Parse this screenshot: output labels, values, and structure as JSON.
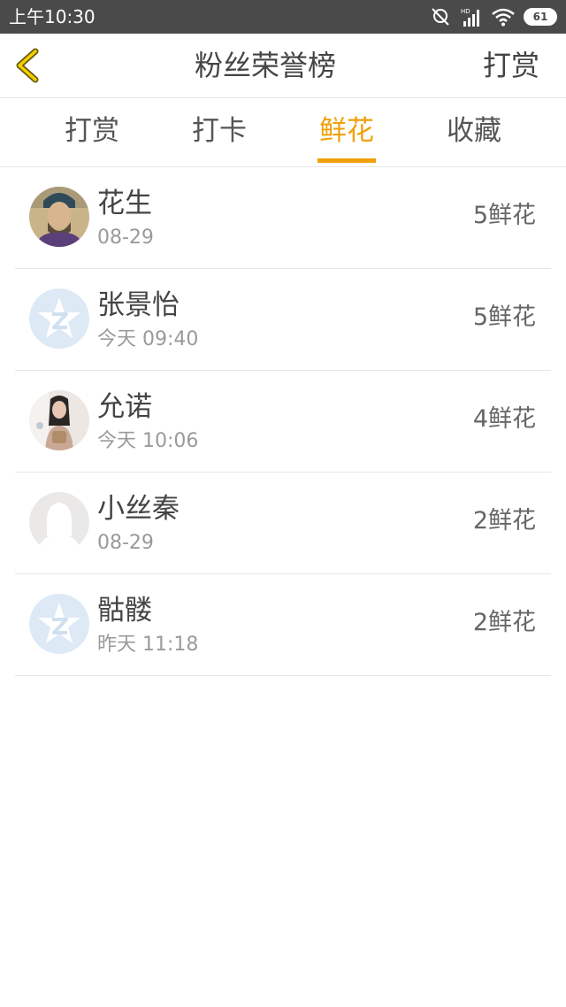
{
  "status_bar": {
    "time": "上午10:30",
    "hd_label": "HD",
    "battery": "61"
  },
  "header": {
    "title": "粉丝荣誉榜",
    "action": "打赏"
  },
  "tabs": [
    {
      "label": "打赏",
      "active": false
    },
    {
      "label": "打卡",
      "active": false
    },
    {
      "label": "鲜花",
      "active": true
    },
    {
      "label": "收藏",
      "active": false
    }
  ],
  "colors": {
    "accent": "#f0a00a",
    "status_bar": "#4a4a4a"
  },
  "list": [
    {
      "name": "花生",
      "time": "08-29",
      "count": "5鲜花",
      "avatar": "portrait-photo"
    },
    {
      "name": "张景怡",
      "time": "今天 09:40",
      "count": "5鲜花",
      "avatar": "default-qq-icon"
    },
    {
      "name": "允诺",
      "time": "今天 10:06",
      "count": "4鲜花",
      "avatar": "girl-photo"
    },
    {
      "name": "小丝秦",
      "time": "08-29",
      "count": "2鲜花",
      "avatar": "silhouette-placeholder"
    },
    {
      "name": "骷髅",
      "time": "昨天 11:18",
      "count": "2鲜花",
      "avatar": "default-qq-icon"
    }
  ]
}
